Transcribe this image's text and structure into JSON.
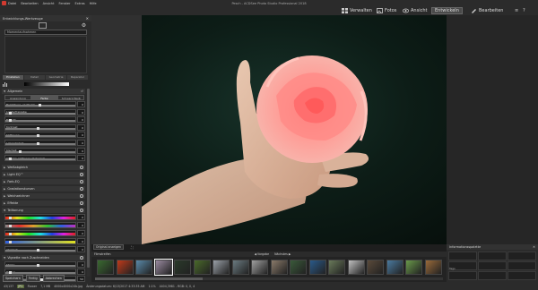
{
  "window": {
    "title": "Pesch - ACDSee Photo Studio Professional 2018"
  },
  "menu": [
    "Datei",
    "Bearbeiten",
    "Ansicht",
    "Fenster",
    "Extras",
    "Hilfe"
  ],
  "modes": [
    {
      "label": "Verwalten",
      "active": false
    },
    {
      "label": "Fotos",
      "active": false
    },
    {
      "label": "Ansicht",
      "active": false
    },
    {
      "label": "Entwickeln",
      "active": true
    },
    {
      "label": "Bearbeiten",
      "active": false
    }
  ],
  "left_panel": {
    "title": "Entwicklungs-Werkzeuge",
    "preset_label": "Momentaufnahmen",
    "subtabs": [
      "Einstellen",
      "Detail",
      "Geometrie",
      "Reparatur"
    ],
    "sections": {
      "allgemein": "Allgemein",
      "wei": "Weißabgleich",
      "light": "Light EQ™",
      "farb": "Farb-EQ",
      "grad": "Gradationskurven",
      "weich": "Weichzeichner",
      "effekte": "Effekte",
      "teil": "Teiltonung",
      "vign": "Vignette nach Zuschneiden"
    },
    "mode_tabs": [
      "Anwendung",
      "Farbe",
      "Schwarz-Weiß"
    ],
    "allgemein_sliders": [
      {
        "label": "Belichtung +0,05 LW",
        "value": "0",
        "pos": 0.48
      },
      {
        "label": "Lichterfreigabe",
        "value": "0",
        "pos": 0.05
      },
      {
        "label": "Füllicht",
        "value": "0",
        "pos": 0.05
      },
      {
        "label": "Kontrast",
        "value": "0",
        "pos": 0.45
      },
      {
        "label": "Sättigung",
        "value": "0",
        "pos": 0.45
      },
      {
        "label": "Lebendigkeit",
        "value": "0",
        "pos": 0.45
      },
      {
        "label": "Klarheit",
        "value": "0",
        "pos": 0.2
      },
      {
        "label": "Chroma entfernen (Schwarz)",
        "value": "0",
        "pos": 0.05
      }
    ],
    "teil_sliders": [
      {
        "label": "Lichter - Farbton",
        "value": "0",
        "pos": 0.05,
        "grad": "rb"
      },
      {
        "label": "Lichter - Sättigung",
        "value": "0",
        "pos": 0.05,
        "grad": "sat"
      },
      {
        "label": "Schatten - Farbton",
        "value": "0",
        "pos": 0.05,
        "grad": "rb"
      },
      {
        "label": "Schatten - Sättigung",
        "value": "0",
        "pos": 0.05,
        "grad": "yel"
      },
      {
        "label": "Abgleich",
        "value": "0",
        "pos": 0.45,
        "grad": ""
      }
    ],
    "vign_sliders": [
      {
        "label": "Stärke",
        "value": "0",
        "pos": 0.45
      },
      {
        "label": "Radius",
        "value": "0",
        "pos": 0.05
      },
      {
        "label": "Weiche Kanten",
        "value": "50",
        "pos": 0.5
      }
    ],
    "bottom_buttons": [
      "Speichern",
      "Fertig",
      "Abbrechen"
    ]
  },
  "stage": {
    "original_button": "Original anzeigen"
  },
  "film": {
    "title": "Filmstreifen",
    "prev": "Vorgabe",
    "next": "Nächstes",
    "thumb_colors": [
      "#3a6a30",
      "#c03a1a",
      "#5a8aaa",
      "#9a8aa0",
      "#2a3a2a",
      "#4a6a2a",
      "#9aa0a8",
      "#6a7a80",
      "#a0a0a0",
      "#8a7a6a",
      "#3a5a3a",
      "#2a5a8a",
      "#6a7a5a",
      "#c0c0c0",
      "#5a4a3a",
      "#4a7aa0",
      "#6a9a4a",
      "#9a6a3a"
    ]
  },
  "right_bottom": {
    "title": "Informationsspalette",
    "label": "Tags"
  },
  "status": {
    "counter": "43/137",
    "badge": "JPG",
    "items": [
      "Flower",
      "7,1 MB",
      "4000x4000x24b.jpg",
      "Änderungsdatum: 6/13/2017 4:33:35 AM",
      "1:1%",
      "4404,3981 - RGB: 0, 0, 4"
    ]
  },
  "colors": {
    "accent": "#d23a30",
    "panel": "#2b2b2b",
    "bg": "#1e1e1e"
  }
}
